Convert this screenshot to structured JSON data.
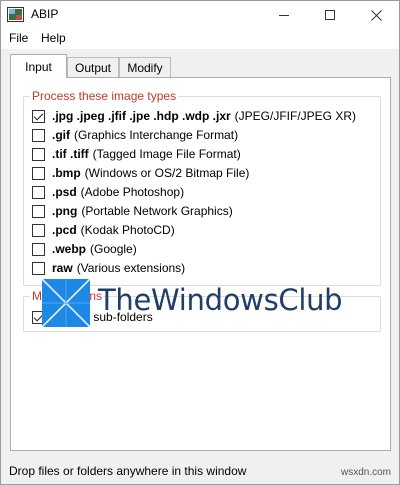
{
  "window": {
    "title": "ABIP"
  },
  "menu": {
    "file": "File",
    "help": "Help"
  },
  "tabs": [
    {
      "label": "Input",
      "active": true
    },
    {
      "label": "Output",
      "active": false
    },
    {
      "label": "Modify",
      "active": false
    }
  ],
  "image_types": {
    "legend": "Process these image types",
    "items": [
      {
        "ext": ".jpg .jpeg .jfif .jpe .hdp .wdp .jxr",
        "desc": "(JPEG/JFIF/JPEG XR)",
        "checked": true
      },
      {
        "ext": ".gif",
        "desc": "(Graphics Interchange Format)",
        "checked": false
      },
      {
        "ext": ".tif .tiff",
        "desc": "(Tagged Image File Format)",
        "checked": false
      },
      {
        "ext": ".bmp",
        "desc": "(Windows or OS/2 Bitmap File)",
        "checked": false
      },
      {
        "ext": ".psd",
        "desc": "(Adobe Photoshop)",
        "checked": false
      },
      {
        "ext": ".png",
        "desc": "(Portable Network Graphics)",
        "checked": false
      },
      {
        "ext": ".pcd",
        "desc": "(Kodak PhotoCD)",
        "checked": false
      },
      {
        "ext": ".webp",
        "desc": "(Google)",
        "checked": false
      },
      {
        "ext": "raw",
        "desc": "(Various extensions)",
        "checked": false
      }
    ]
  },
  "misc": {
    "legend": "Misc. options",
    "search_subfolders": {
      "label": "Search sub-folders",
      "checked": true
    }
  },
  "watermark": {
    "text": "TheWindowsClub"
  },
  "status": {
    "text": "Drop files or folders anywhere in this window"
  },
  "site_mark": "wsxdn.com",
  "colors": {
    "legend": "#c0392b",
    "logo_text": "#1f3f66",
    "logo_blue": "#1e88e5"
  }
}
